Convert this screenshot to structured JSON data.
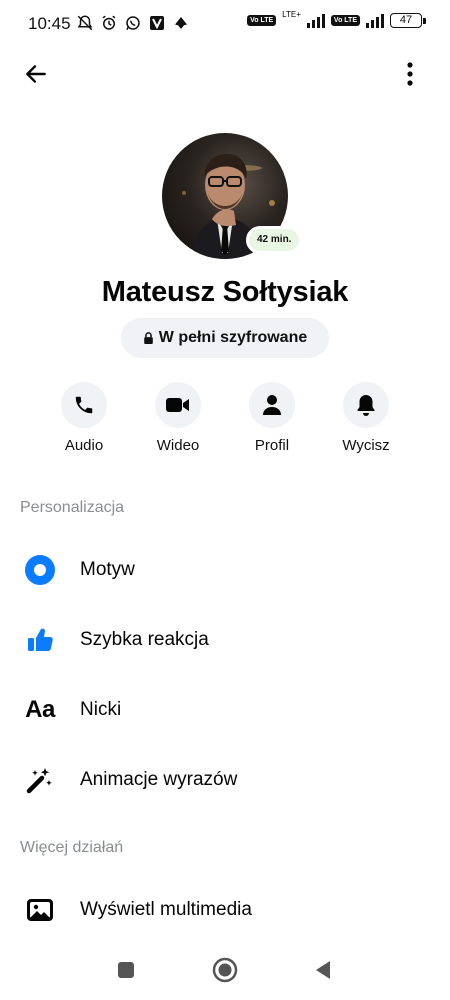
{
  "status_bar": {
    "time": "10:45",
    "lte": "LTE+",
    "volte_1": "Vo LTE",
    "volte_2": "Vo LTE",
    "battery": "47"
  },
  "profile": {
    "name": "Mateusz Sołtysiak",
    "active_status": "42 min.",
    "encryption_label": "W pełni szyfrowane"
  },
  "actions": [
    {
      "label": "Audio",
      "icon": "phone-icon"
    },
    {
      "label": "Wideo",
      "icon": "video-camera-icon"
    },
    {
      "label": "Profil",
      "icon": "person-icon"
    },
    {
      "label": "Wycisz",
      "icon": "bell-icon"
    }
  ],
  "sections": {
    "personalization": {
      "title": "Personalizacja",
      "items": [
        {
          "label": "Motyw",
          "icon": "theme-icon"
        },
        {
          "label": "Szybka reakcja",
          "icon": "thumbs-up-icon"
        },
        {
          "label": "Nicki",
          "icon": "font-aa-icon"
        },
        {
          "label": "Animacje wyrazów",
          "icon": "magic-wand-icon"
        }
      ]
    },
    "more_actions": {
      "title": "Więcej działań",
      "items": [
        {
          "label": "Wyświetl multimedia",
          "icon": "image-icon"
        }
      ]
    }
  },
  "icon_texts": {
    "font_aa": "Aa"
  },
  "colors": {
    "accent": "#0a7cff",
    "button_bg": "#f0f2f5",
    "section_header": "#8a8d91",
    "active_badge_bg": "#eaf6e4"
  }
}
